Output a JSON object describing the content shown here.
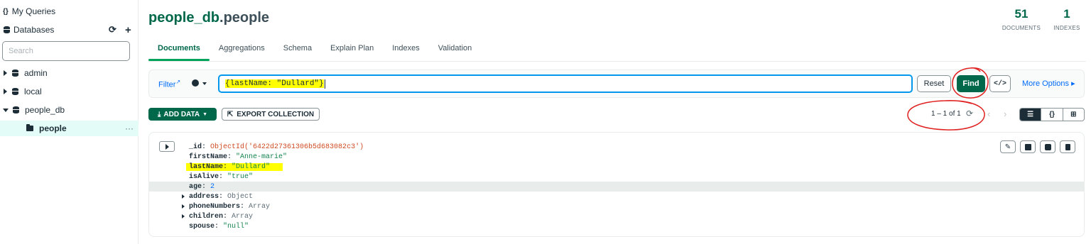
{
  "sidebar": {
    "my_queries_icon": "{}",
    "my_queries": "My Queries",
    "databases": "Databases",
    "search_placeholder": "Search",
    "items": [
      {
        "label": "admin"
      },
      {
        "label": "local"
      },
      {
        "label": "people_db"
      }
    ],
    "collection": "people",
    "collection_more": "···"
  },
  "header": {
    "db": "people_db",
    "coll": ".people",
    "documents_count": "51",
    "documents_label": "DOCUMENTS",
    "indexes_count": "1",
    "indexes_label": "INDEXES"
  },
  "tabs": [
    "Documents",
    "Aggregations",
    "Schema",
    "Explain Plan",
    "Indexes",
    "Validation"
  ],
  "query_bar": {
    "filter_label": "Filter",
    "filter_value": "{lastName: \"Dullard\"}",
    "reset_label": "Reset",
    "find_label": "Find",
    "code_label": "</>",
    "more_options_label": "More Options ▸"
  },
  "toolbar": {
    "add_data_label": "ADD DATA",
    "export_label": "EXPORT COLLECTION",
    "pager_text": "1 – 1 of 1",
    "view_list": "☰",
    "view_json": "{}",
    "view_table": "⊞"
  },
  "document": {
    "fields": [
      {
        "key": "_id",
        "value": "ObjectId('6422d27361306b5d683082c3')",
        "type": "objectid"
      },
      {
        "key": "firstName",
        "value": "\"Anne-marie\"",
        "type": "string"
      },
      {
        "key": "lastName",
        "value": "\"Dullard\"",
        "type": "string"
      },
      {
        "key": "isAlive",
        "value": "\"true\"",
        "type": "string"
      },
      {
        "key": "age",
        "value": "2",
        "type": "number"
      },
      {
        "key": "address",
        "value": "Object",
        "type": "type"
      },
      {
        "key": "phoneNumbers",
        "value": "Array",
        "type": "type"
      },
      {
        "key": "children",
        "value": "Array",
        "type": "type"
      },
      {
        "key": "spouse",
        "value": "\"null\"",
        "type": "string"
      }
    ]
  },
  "colors": {
    "brand_green": "#00684a",
    "link_blue": "#016bf8",
    "focus_blue": "#0498ec",
    "highlight": "#ffff00",
    "annotation_red": "#e02020"
  }
}
